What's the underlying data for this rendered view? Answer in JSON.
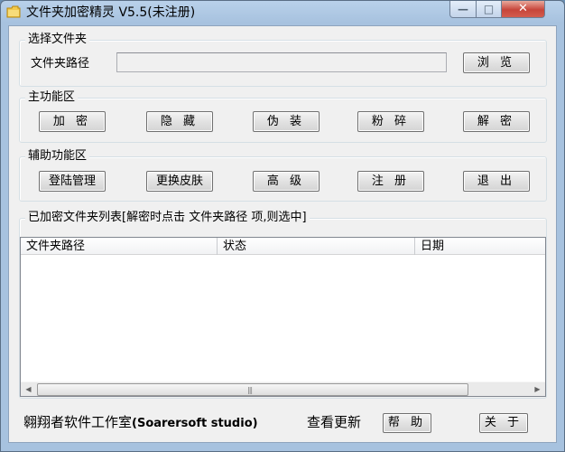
{
  "window": {
    "title": "文件夹加密精灵 V5.5(未注册)",
    "controls": {
      "minimize": "—",
      "maximize": "□",
      "close": "✕"
    }
  },
  "select_folder": {
    "group_label": "选择文件夹",
    "path_label": "文件夹路径",
    "path_value": "",
    "browse_label": "浏 览"
  },
  "main_functions": {
    "group_label": "主功能区",
    "buttons": [
      "加 密",
      "隐 藏",
      "伪 装",
      "粉 碎",
      "解 密"
    ]
  },
  "aux_functions": {
    "group_label": "辅助功能区",
    "buttons": [
      "登陆管理",
      "更换皮肤",
      "高 级",
      "注 册",
      "退 出"
    ]
  },
  "encrypted_list": {
    "group_label": "已加密文件夹列表[解密时点击 文件夹路径 项,则选中]",
    "columns": [
      "文件夹路径",
      "状态",
      "日期"
    ],
    "rows": []
  },
  "footer": {
    "studio": "翱翔者软件工作室",
    "studio_en": "(Soarersoft studio)",
    "check_update": "查看更新",
    "help_label": "帮 助",
    "about_label": "关 于"
  },
  "colors": {
    "title_bar": "#b9d1ea",
    "client_bg": "#f0f0f0",
    "close_button": "#c7453a"
  }
}
